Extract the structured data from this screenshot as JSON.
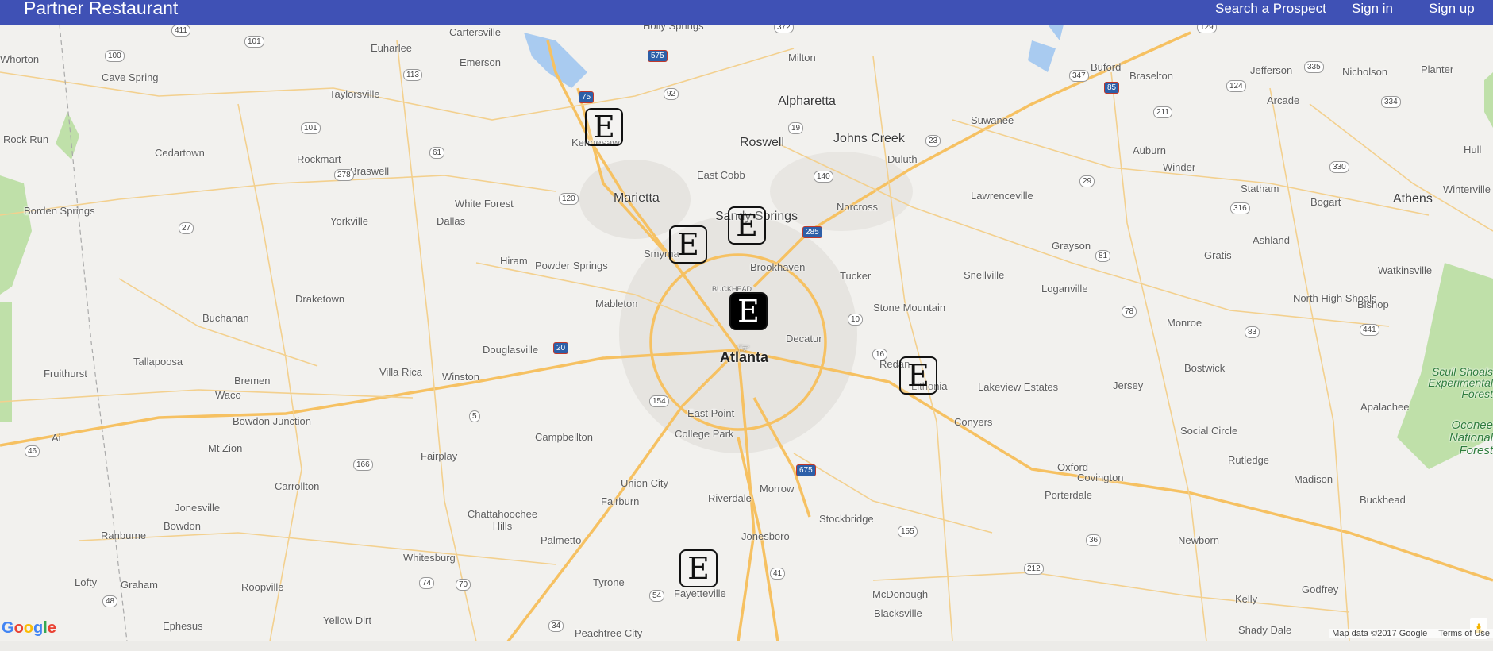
{
  "app": {
    "brand": "Partner Restaurant"
  },
  "nav": {
    "search_prospect": "Search a Prospect",
    "sign_in": "Sign in",
    "sign_up": "Sign up"
  },
  "colors": {
    "navbar": "#3f51b5",
    "map_background": "#f2f1ee",
    "highway": "#f6c162",
    "water": "#a9cbf0",
    "park": "#bfe0a9"
  },
  "map": {
    "places": [
      {
        "label": "Whorton",
        "cls": "place"
      },
      {
        "label": "Euharlee",
        "cls": "place"
      },
      {
        "label": "Cartersville",
        "cls": "place"
      },
      {
        "label": "Holly Springs",
        "cls": "place"
      },
      {
        "label": "Milton",
        "cls": "place"
      },
      {
        "label": "Buford",
        "cls": "place"
      },
      {
        "label": "Braselton",
        "cls": "place"
      },
      {
        "label": "Jefferson",
        "cls": "place"
      },
      {
        "label": "Nicholson",
        "cls": "place"
      },
      {
        "label": "Planter",
        "cls": "place"
      },
      {
        "label": "Cave Spring",
        "cls": "place"
      },
      {
        "label": "Emerson",
        "cls": "place"
      },
      {
        "label": "Alpharetta",
        "cls": "major"
      },
      {
        "label": "Arcade",
        "cls": "place"
      },
      {
        "label": "Taylorsville",
        "cls": "place"
      },
      {
        "label": "Suwanee",
        "cls": "place"
      },
      {
        "label": "Rock Run",
        "cls": "place"
      },
      {
        "label": "Kennesaw",
        "cls": "place"
      },
      {
        "label": "Roswell",
        "cls": "major"
      },
      {
        "label": "Johns Creek",
        "cls": "major"
      },
      {
        "label": "Auburn",
        "cls": "place"
      },
      {
        "label": "Hull",
        "cls": "place"
      },
      {
        "label": "Cedartown",
        "cls": "place"
      },
      {
        "label": "Rockmart",
        "cls": "place"
      },
      {
        "label": "Duluth",
        "cls": "place"
      },
      {
        "label": "Winder",
        "cls": "place"
      },
      {
        "label": "East Cobb",
        "cls": "place"
      },
      {
        "label": "Braswell",
        "cls": "place"
      },
      {
        "label": "Statham",
        "cls": "place"
      },
      {
        "label": "Bogart",
        "cls": "place"
      },
      {
        "label": "Winterville",
        "cls": "place"
      },
      {
        "label": "Borden Springs",
        "cls": "place"
      },
      {
        "label": "Lawrenceville",
        "cls": "place"
      },
      {
        "label": "Athens",
        "cls": "major"
      },
      {
        "label": "Marietta",
        "cls": "major"
      },
      {
        "label": "White Forest",
        "cls": "place"
      },
      {
        "label": "Sandy Springs",
        "cls": "major"
      },
      {
        "label": "Norcross",
        "cls": "place"
      },
      {
        "label": "Yorkville",
        "cls": "place"
      },
      {
        "label": "Dallas",
        "cls": "place"
      },
      {
        "label": "Smyrna",
        "cls": "place"
      },
      {
        "label": "Grayson",
        "cls": "place"
      },
      {
        "label": "Ashland",
        "cls": "place"
      },
      {
        "label": "Gratis",
        "cls": "place"
      },
      {
        "label": "Hiram",
        "cls": "place"
      },
      {
        "label": "Powder Springs",
        "cls": "place"
      },
      {
        "label": "Brookhaven",
        "cls": "place"
      },
      {
        "label": "Watkinsville",
        "cls": "place"
      },
      {
        "label": "Tucker",
        "cls": "place"
      },
      {
        "label": "Snellville",
        "cls": "place"
      },
      {
        "label": "Loganville",
        "cls": "place"
      },
      {
        "label": "BUCKHEAD",
        "cls": "small"
      },
      {
        "label": "Draketown",
        "cls": "place"
      },
      {
        "label": "North High Shoals",
        "cls": "place"
      },
      {
        "label": "Bishop",
        "cls": "place"
      },
      {
        "label": "Mableton",
        "cls": "place"
      },
      {
        "label": "Stone Mountain",
        "cls": "place"
      },
      {
        "label": "Buchanan",
        "cls": "place"
      },
      {
        "label": "Monroe",
        "cls": "place"
      },
      {
        "label": "Decatur",
        "cls": "place"
      },
      {
        "label": "Douglasville",
        "cls": "place"
      },
      {
        "label": "Atlanta",
        "cls": "city"
      },
      {
        "label": "Tallapoosa",
        "cls": "place"
      },
      {
        "label": "Redan",
        "cls": "place"
      },
      {
        "label": "Bostwick",
        "cls": "place"
      },
      {
        "label": "Scull Shoals Experimental Forest",
        "cls": "forest"
      },
      {
        "label": "Fruithurst",
        "cls": "place"
      },
      {
        "label": "Villa Rica",
        "cls": "place"
      },
      {
        "label": "Winston",
        "cls": "place"
      },
      {
        "label": "Bremen",
        "cls": "place"
      },
      {
        "label": "Lithonia",
        "cls": "place"
      },
      {
        "label": "Lakeview Estates",
        "cls": "place"
      },
      {
        "label": "Jersey",
        "cls": "place"
      },
      {
        "label": "Waco",
        "cls": "place"
      },
      {
        "label": "Apalachee",
        "cls": "place"
      },
      {
        "label": "East Point",
        "cls": "place"
      },
      {
        "label": "Bowdon Junction",
        "cls": "place"
      },
      {
        "label": "Conyers",
        "cls": "place"
      },
      {
        "label": "Ai",
        "cls": "place"
      },
      {
        "label": "Oconee National Forest",
        "cls": "forest"
      },
      {
        "label": "College Park",
        "cls": "place"
      },
      {
        "label": "Social Circle",
        "cls": "place"
      },
      {
        "label": "Mt Zion",
        "cls": "place"
      },
      {
        "label": "Campbellton",
        "cls": "place"
      },
      {
        "label": "Fairplay",
        "cls": "place"
      },
      {
        "label": "Rutledge",
        "cls": "place"
      },
      {
        "label": "Oxford",
        "cls": "place"
      },
      {
        "label": "Covington",
        "cls": "place"
      },
      {
        "label": "Carrollton",
        "cls": "place"
      },
      {
        "label": "Union City",
        "cls": "place"
      },
      {
        "label": "Morrow",
        "cls": "place"
      },
      {
        "label": "Madison",
        "cls": "place"
      },
      {
        "label": "Riverdale",
        "cls": "place"
      },
      {
        "label": "Porterdale",
        "cls": "place"
      },
      {
        "label": "Jonesville",
        "cls": "place"
      },
      {
        "label": "Fairburn",
        "cls": "place"
      },
      {
        "label": "Buckhead",
        "cls": "place"
      },
      {
        "label": "Chattahoochee Hills",
        "cls": "place"
      },
      {
        "label": "Stockbridge",
        "cls": "place"
      },
      {
        "label": "Bowdon",
        "cls": "place"
      },
      {
        "label": "Ranburne",
        "cls": "place"
      },
      {
        "label": "Palmetto",
        "cls": "place"
      },
      {
        "label": "Jonesboro",
        "cls": "place"
      },
      {
        "label": "Newborn",
        "cls": "place"
      },
      {
        "label": "Whitesburg",
        "cls": "place"
      },
      {
        "label": "Roopville",
        "cls": "place"
      },
      {
        "label": "Tyrone",
        "cls": "place"
      },
      {
        "label": "Lofty",
        "cls": "place"
      },
      {
        "label": "Graham",
        "cls": "place"
      },
      {
        "label": "Godfrey",
        "cls": "place"
      },
      {
        "label": "Fayetteville",
        "cls": "place"
      },
      {
        "label": "McDonough",
        "cls": "place"
      },
      {
        "label": "Kelly",
        "cls": "place"
      },
      {
        "label": "Blacksville",
        "cls": "place"
      },
      {
        "label": "Ephesus",
        "cls": "place"
      },
      {
        "label": "Yellow Dirt",
        "cls": "place"
      },
      {
        "label": "Peachtree City",
        "cls": "place"
      },
      {
        "label": "Shady Dale",
        "cls": "place"
      }
    ],
    "route_shields": [
      {
        "label": "411",
        "interstate": false
      },
      {
        "label": "100",
        "interstate": false
      },
      {
        "label": "101",
        "interstate": false
      },
      {
        "label": "575",
        "interstate": true
      },
      {
        "label": "372",
        "interstate": false
      },
      {
        "label": "129",
        "interstate": false
      },
      {
        "label": "113",
        "interstate": false
      },
      {
        "label": "75",
        "interstate": true
      },
      {
        "label": "92",
        "interstate": false
      },
      {
        "label": "347",
        "interstate": false
      },
      {
        "label": "85",
        "interstate": true
      },
      {
        "label": "335",
        "interstate": false
      },
      {
        "label": "124",
        "interstate": false
      },
      {
        "label": "334",
        "interstate": false
      },
      {
        "label": "101",
        "interstate": false
      },
      {
        "label": "19",
        "interstate": false
      },
      {
        "label": "23",
        "interstate": false
      },
      {
        "label": "211",
        "interstate": false
      },
      {
        "label": "61",
        "interstate": false
      },
      {
        "label": "278",
        "interstate": false
      },
      {
        "label": "140",
        "interstate": false
      },
      {
        "label": "330",
        "interstate": false
      },
      {
        "label": "120",
        "interstate": false
      },
      {
        "label": "285",
        "interstate": true
      },
      {
        "label": "29",
        "interstate": false
      },
      {
        "label": "316",
        "interstate": false
      },
      {
        "label": "27",
        "interstate": false
      },
      {
        "label": "20",
        "interstate": true
      },
      {
        "label": "10",
        "interstate": false
      },
      {
        "label": "78",
        "interstate": false
      },
      {
        "label": "441",
        "interstate": false
      },
      {
        "label": "154",
        "interstate": false
      },
      {
        "label": "166",
        "interstate": false
      },
      {
        "label": "675",
        "interstate": true
      },
      {
        "label": "155",
        "interstate": false
      },
      {
        "label": "212",
        "interstate": false
      },
      {
        "label": "36",
        "interstate": false
      },
      {
        "label": "41",
        "interstate": false
      },
      {
        "label": "54",
        "interstate": false
      },
      {
        "label": "74",
        "interstate": false
      },
      {
        "label": "34",
        "interstate": false
      },
      {
        "label": "5",
        "interstate": false
      },
      {
        "label": "16",
        "interstate": false
      },
      {
        "label": "70",
        "interstate": false
      },
      {
        "label": "48",
        "interstate": false
      },
      {
        "label": "46",
        "interstate": false
      },
      {
        "label": "81",
        "interstate": false
      },
      {
        "label": "83",
        "interstate": false
      }
    ],
    "markers": [
      {
        "label": "E",
        "name": "marker-kennesaw",
        "selected": false
      },
      {
        "label": "E",
        "name": "marker-sandy-springs",
        "selected": false
      },
      {
        "label": "E",
        "name": "marker-smyrna",
        "selected": false
      },
      {
        "label": "E",
        "name": "marker-buckhead",
        "selected": true
      },
      {
        "label": "E",
        "name": "marker-lithonia",
        "selected": false
      },
      {
        "label": "E",
        "name": "marker-fayetteville",
        "selected": false
      }
    ],
    "google_logo": "Google",
    "map_data": "Map data ©2017 Google",
    "terms": "Terms of Use"
  }
}
